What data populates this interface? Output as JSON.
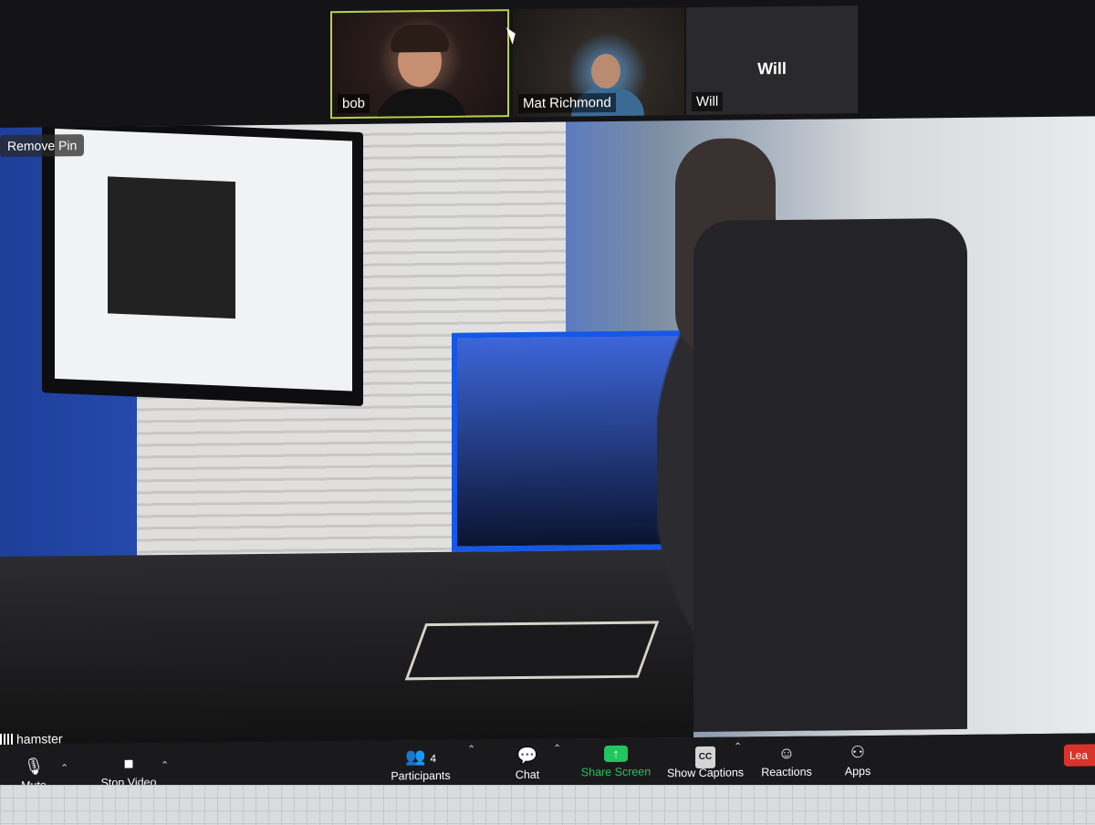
{
  "participants_strip": [
    {
      "name": "bob",
      "active_speaker": true
    },
    {
      "name": "Mat Richmond",
      "active_speaker": false
    },
    {
      "name": "Will",
      "center_label": "Will",
      "video_off": true
    }
  ],
  "main_video": {
    "remove_pin_label": "Remove Pin",
    "speaker_label": "hamster"
  },
  "toolbar": {
    "mute_label": "Mute",
    "stop_video_label": "Stop Video",
    "participants_label": "Participants",
    "participants_count": "4",
    "chat_label": "Chat",
    "share_screen_label": "Share Screen",
    "show_captions_label": "Show Captions",
    "cc_label": "CC",
    "reactions_label": "Reactions",
    "apps_label": "Apps",
    "leave_label": "Lea"
  },
  "colors": {
    "active_speaker_border": "#b8d14a",
    "share_screen": "#22c55e",
    "leave": "#d9342b",
    "toolbar_bg": "#1a1a1c"
  }
}
